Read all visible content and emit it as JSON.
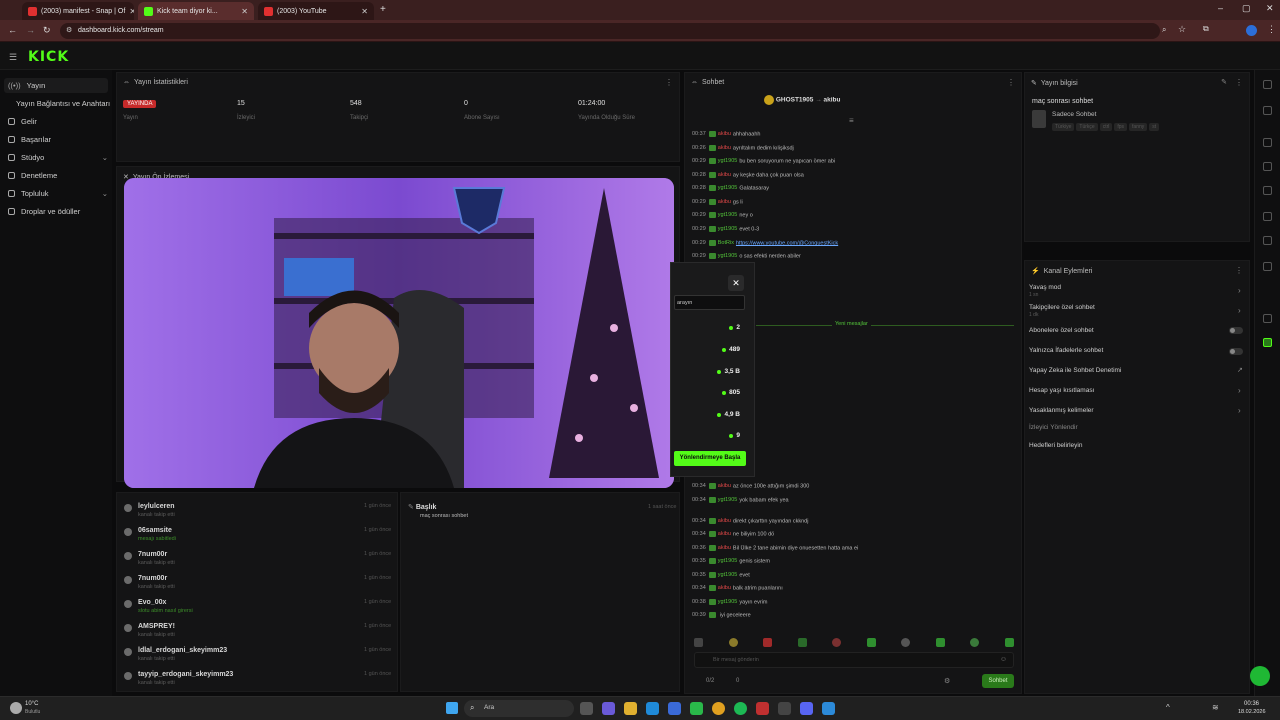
{
  "browser": {
    "tabs": [
      {
        "label": "(2003) manifest - Snap | Of",
        "color": "#e03030"
      },
      {
        "label": "Kick team diyor ki...",
        "color": "#53fc18"
      },
      {
        "label": "(2003) YouTube",
        "color": "#e03030"
      }
    ],
    "url": "dashboard.kick.com/stream"
  },
  "sidebar": {
    "items": [
      {
        "label": "Yayın",
        "icon": "broadcast-icon"
      },
      {
        "label": "Yayın Bağlantısı ve Anahtarı",
        "icon": ""
      },
      {
        "label": "Gelir",
        "icon": "revenue-icon"
      },
      {
        "label": "Başarılar",
        "icon": "trophy-icon"
      },
      {
        "label": "Stüdyo",
        "icon": "studio-icon"
      },
      {
        "label": "Denetleme",
        "icon": "shield-icon"
      },
      {
        "label": "Topluluk",
        "icon": "community-icon"
      },
      {
        "label": "Droplar ve ödüller",
        "icon": "gift-icon"
      }
    ]
  },
  "stats": {
    "title": "Yayın İstatistikleri",
    "live": "YAYINDA",
    "followers_label": "Yayın",
    "viewers": "15",
    "viewers_label": "İzleyici",
    "followers": "548",
    "followers_label2": "Takipçi",
    "subs": "0",
    "subs_label": "Abone Sayısı",
    "duration": "01:24:00",
    "duration_label": "Yayında Olduğu Süre"
  },
  "preview": {
    "title": "Yayın Ön İzlemesi"
  },
  "activity": {
    "items": [
      {
        "name": "leylulceren",
        "sub": "kanalı takip etti",
        "time": "1 gün önce"
      },
      {
        "name": "06samsite",
        "sub": "mesajı sabitledi",
        "time": "1 gün önce"
      },
      {
        "name": "7num00r",
        "sub": "kanalı takip etti",
        "time": "1 gün önce"
      },
      {
        "name": "7num00r",
        "sub": "kanalı takip etti",
        "time": "1 gün önce"
      },
      {
        "name": "Evo_00x",
        "sub": "slotu abim nasıl girersi",
        "time": "1 gün önce"
      },
      {
        "name": "AMSPREY!",
        "sub": "kanalı takip etti",
        "time": "1 gün önce"
      },
      {
        "name": "ldlal_erdogani_skeyimm23",
        "sub": "kanalı takip etti",
        "time": "1 gün önce"
      },
      {
        "name": "tayyip_erdogani_skeyimm23",
        "sub": "kanalı takip etti",
        "time": "1 gün önce"
      }
    ],
    "title_item": {
      "label": "Başlık",
      "detail": "maç sonrası sohbet",
      "time": "1 saat önce"
    }
  },
  "chat": {
    "title": "Sohbet",
    "pinned_user": "GHOST1905",
    "pinned_user2": "akibu",
    "new_messages": "Yeni mesajlar",
    "input_placeholder": "Bir mesaj gönderin",
    "send_label": "Sohbet",
    "bottom_stat": "0/2",
    "bottom_stat2": "0",
    "messages": [
      {
        "time": "00:37",
        "user": "akibu",
        "text": "ahhahaahh",
        "red": true
      },
      {
        "time": "00:26",
        "user": "akibu",
        "text": "ayrıltalım dedim kılişiksdj",
        "red": true
      },
      {
        "time": "00:29",
        "user": "ygt1905",
        "text": "bu ben soruyorum ne yapıcan ömer abi",
        "red": false
      },
      {
        "time": "00:28",
        "user": "akibu",
        "text": "ay keşke daha çok puan olsa",
        "red": true
      },
      {
        "time": "00:28",
        "user": "ygt1905",
        "text": "Galatasaray",
        "red": false
      },
      {
        "time": "00:29",
        "user": "akibu",
        "text": "gs li",
        "red": true
      },
      {
        "time": "00:29",
        "user": "ygt1905",
        "text": "ney o",
        "red": false
      },
      {
        "time": "00:29",
        "user": "ygt1905",
        "text": "evet 0-3",
        "red": false
      },
      {
        "time": "00:29",
        "user": "BotRix",
        "text": "https://www.youtube.com/@ConquestKick",
        "red": false
      },
      {
        "time": "00:29",
        "user": "ygt1905",
        "text": "o sas efekti nerden abiler",
        "red": false
      }
    ],
    "messages2": [
      {
        "time": "00:34",
        "user": "akibu",
        "text": "az önce 100e attığım şimdi 300",
        "red": true
      },
      {
        "time": "00:34",
        "user": "ygt1905",
        "text": "yok babam efek yea",
        "red": false
      },
      {
        "time": "00:34",
        "user": "akibu",
        "text": "direkt çıkarttın yayından ckkndj",
        "red": true
      },
      {
        "time": "00:34",
        "user": "akibu",
        "text": "ne biliyim 100 dö",
        "red": true
      },
      {
        "time": "00:36",
        "user": "akibu",
        "text": "Bil Ülke 2 tane abimin diye onuesetten hatta ama ei",
        "red": true
      },
      {
        "time": "00:35",
        "user": "ygt1905",
        "text": "genis sistem",
        "red": false
      },
      {
        "time": "00:35",
        "user": "ygt1905",
        "text": "evet",
        "red": false
      },
      {
        "time": "00:34",
        "user": "akibu",
        "text": "balk atrim puanlarını",
        "red": true
      },
      {
        "time": "00:38",
        "user": "ygt1905",
        "text": "yayın evrim",
        "red": false
      },
      {
        "time": "00:39",
        "user": "",
        "text": "iyi geceleere",
        "red": true
      }
    ]
  },
  "overlay": {
    "search_placeholder": "arayın",
    "rows": [
      "2",
      "489",
      "3,5 B",
      "805",
      "4,9 B",
      "9"
    ],
    "button": "Yönlendirmeye Başla"
  },
  "stream_info": {
    "title": "Yayın bilgisi",
    "stream_title": "maç sonrası sohbet",
    "category": "Sadece Sohbet",
    "tags": [
      "Türkiye",
      "Türkçe",
      "ctrl",
      "fps",
      "fanny",
      "st"
    ]
  },
  "channel_actions": {
    "title": "Kanal Eylemleri",
    "items": [
      {
        "label": "Yavaş mod",
        "sub": "1 sn"
      },
      {
        "label": "Takipçilere özel sohbet",
        "sub": "1 dk"
      },
      {
        "label": "Abonelere özel sohbet",
        "sub": ""
      },
      {
        "label": "Yalnızca İfadelerle sohbet",
        "sub": ""
      },
      {
        "label": "Yapay Zeka ile Sohbet Denetimi",
        "sub": ""
      },
      {
        "label": "Hesap yaşı kısıtlaması",
        "sub": ""
      },
      {
        "label": "Yasaklanmış kelimeler",
        "sub": ""
      },
      {
        "label": "İzleyici Yönlendir",
        "sub": ""
      },
      {
        "label": "Hedefleri belirleyin",
        "sub": ""
      }
    ]
  },
  "taskbar": {
    "weather": "10°C",
    "weather_sub": "Bulutlu",
    "search": "Ara",
    "time": "00:36",
    "date": "18.02.2026"
  }
}
